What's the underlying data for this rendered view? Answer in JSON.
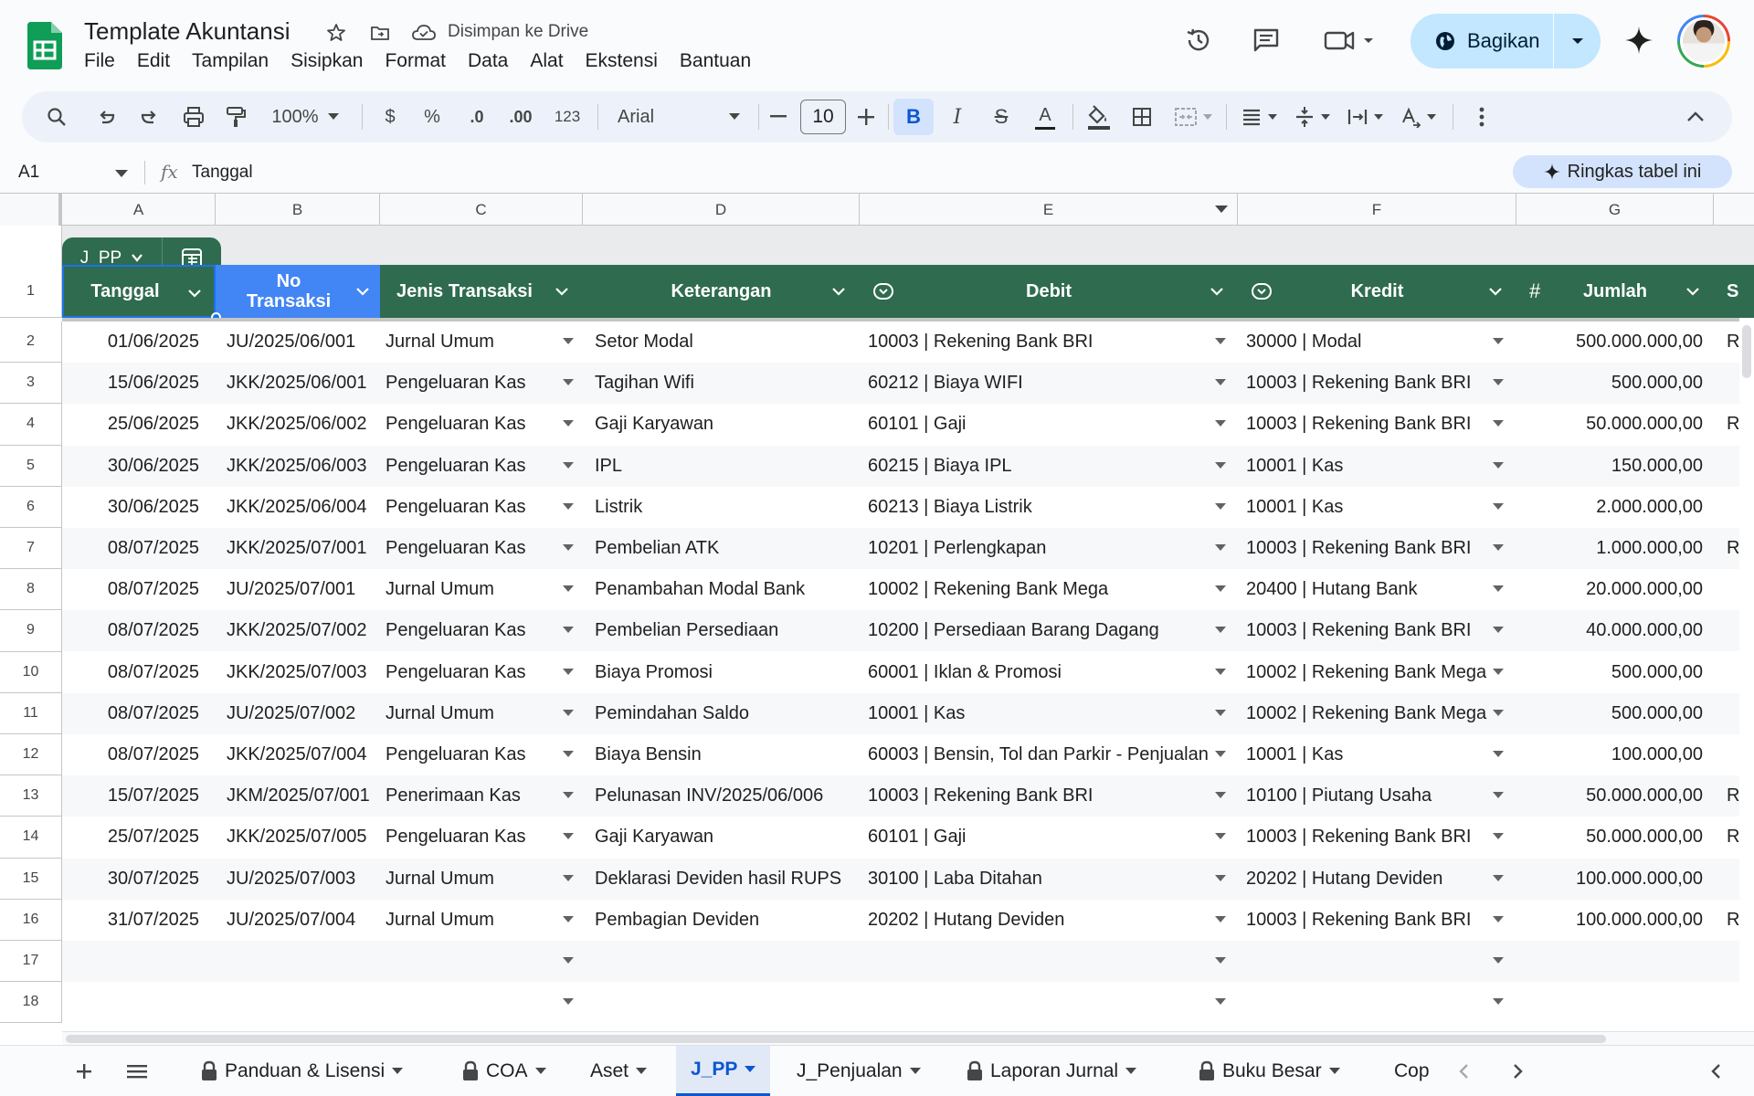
{
  "app": {
    "title": "Template Akuntansi",
    "save_status": "Disimpan ke Drive",
    "share_label": "Bagikan",
    "menus": [
      "File",
      "Edit",
      "Tampilan",
      "Sisipkan",
      "Format",
      "Data",
      "Alat",
      "Ekstensi",
      "Bantuan"
    ]
  },
  "toolbar": {
    "zoom": "100%",
    "currency": "$",
    "percent": "%",
    "decrease_decimal": ".0",
    "increase_decimal": ".00",
    "number_format": "123",
    "font": "Arial",
    "font_size": "10",
    "bold": "B",
    "italic": "I",
    "strike": "S",
    "text_color": "A"
  },
  "formula_bar": {
    "cell_ref": "A1",
    "fx": "fx",
    "value": "Tanggal",
    "ai_button": "Ringkas tabel ini"
  },
  "columns": [
    "A",
    "B",
    "C",
    "D",
    "E",
    "F",
    "G"
  ],
  "table": {
    "name": "J_PP",
    "headers": {
      "tanggal": "Tanggal",
      "no1": "No",
      "no2": "Transaksi",
      "jenis": "Jenis Transaksi",
      "ket": "Keterangan",
      "debit": "Debit",
      "kredit": "Kredit",
      "jumlah_icon": "#",
      "jumlah": "Jumlah",
      "next": "S"
    },
    "rows": [
      {
        "n": "2",
        "tgl": "01/06/2025",
        "no": "JU/2025/06/001",
        "jenis": "Jurnal Umum",
        "ket": "Setor Modal",
        "debit": "10003 | Rekening Bank BRI",
        "kredit": "30000 | Modal",
        "jumlah": "500.000.000,00",
        "next": "R"
      },
      {
        "n": "3",
        "tgl": "15/06/2025",
        "no": "JKK/2025/06/001",
        "jenis": "Pengeluaran Kas",
        "ket": "Tagihan Wifi",
        "debit": "60212 | Biaya WIFI",
        "kredit": "10003 | Rekening Bank BRI",
        "jumlah": "500.000,00",
        "next": ""
      },
      {
        "n": "4",
        "tgl": "25/06/2025",
        "no": "JKK/2025/06/002",
        "jenis": "Pengeluaran Kas",
        "ket": "Gaji Karyawan",
        "debit": "60101 | Gaji",
        "kredit": "10003 | Rekening Bank BRI",
        "jumlah": "50.000.000,00",
        "next": "R"
      },
      {
        "n": "5",
        "tgl": "30/06/2025",
        "no": "JKK/2025/06/003",
        "jenis": "Pengeluaran Kas",
        "ket": "IPL",
        "debit": "60215 | Biaya IPL",
        "kredit": "10001 | Kas",
        "jumlah": "150.000,00",
        "next": ""
      },
      {
        "n": "6",
        "tgl": "30/06/2025",
        "no": "JKK/2025/06/004",
        "jenis": "Pengeluaran Kas",
        "ket": "Listrik",
        "debit": "60213 | Biaya Listrik",
        "kredit": "10001 | Kas",
        "jumlah": "2.000.000,00",
        "next": ""
      },
      {
        "n": "7",
        "tgl": "08/07/2025",
        "no": "JKK/2025/07/001",
        "jenis": "Pengeluaran Kas",
        "ket": "Pembelian ATK",
        "debit": "10201 | Perlengkapan",
        "kredit": "10003 | Rekening Bank BRI",
        "jumlah": "1.000.000,00",
        "next": "R"
      },
      {
        "n": "8",
        "tgl": "08/07/2025",
        "no": "JU/2025/07/001",
        "jenis": "Jurnal Umum",
        "ket": "Penambahan Modal Bank",
        "debit": "10002 | Rekening Bank Mega",
        "kredit": "20400 | Hutang Bank",
        "jumlah": "20.000.000,00",
        "next": ""
      },
      {
        "n": "9",
        "tgl": "08/07/2025",
        "no": "JKK/2025/07/002",
        "jenis": "Pengeluaran Kas",
        "ket": "Pembelian Persediaan",
        "debit": "10200 | Persediaan Barang Dagang",
        "kredit": "10003 | Rekening Bank BRI",
        "jumlah": "40.000.000,00",
        "next": ""
      },
      {
        "n": "10",
        "tgl": "08/07/2025",
        "no": "JKK/2025/07/003",
        "jenis": "Pengeluaran Kas",
        "ket": "Biaya Promosi",
        "debit": "60001 | Iklan & Promosi",
        "kredit": "10002 | Rekening Bank Mega",
        "jumlah": "500.000,00",
        "next": ""
      },
      {
        "n": "11",
        "tgl": "08/07/2025",
        "no": "JU/2025/07/002",
        "jenis": "Jurnal Umum",
        "ket": "Pemindahan Saldo",
        "debit": "10001 | Kas",
        "kredit": "10002 | Rekening Bank Mega",
        "jumlah": "500.000,00",
        "next": ""
      },
      {
        "n": "12",
        "tgl": "08/07/2025",
        "no": "JKK/2025/07/004",
        "jenis": "Pengeluaran Kas",
        "ket": "Biaya Bensin",
        "debit": "60003 | Bensin, Tol dan Parkir - Penjualan",
        "kredit": "10001 | Kas",
        "jumlah": "100.000,00",
        "next": ""
      },
      {
        "n": "13",
        "tgl": "15/07/2025",
        "no": "JKM/2025/07/001",
        "jenis": "Penerimaan Kas",
        "ket": "Pelunasan INV/2025/06/006",
        "debit": "10003 | Rekening Bank BRI",
        "kredit": "10100 | Piutang Usaha",
        "jumlah": "50.000.000,00",
        "next": "R"
      },
      {
        "n": "14",
        "tgl": "25/07/2025",
        "no": "JKK/2025/07/005",
        "jenis": "Pengeluaran Kas",
        "ket": "Gaji Karyawan",
        "debit": "60101 | Gaji",
        "kredit": "10003 | Rekening Bank BRI",
        "jumlah": "50.000.000,00",
        "next": "R"
      },
      {
        "n": "15",
        "tgl": "30/07/2025",
        "no": "JU/2025/07/003",
        "jenis": "Jurnal Umum",
        "ket": "Deklarasi Deviden hasil RUPS",
        "debit": "30100 | Laba Ditahan",
        "kredit": "20202 | Hutang Deviden",
        "jumlah": "100.000.000,00",
        "next": ""
      },
      {
        "n": "16",
        "tgl": "31/07/2025",
        "no": "JU/2025/07/004",
        "jenis": "Jurnal Umum",
        "ket": "Pembagian Deviden",
        "debit": "20202 | Hutang Deviden",
        "kredit": "10003 | Rekening Bank BRI",
        "jumlah": "100.000.000,00",
        "next": "R"
      },
      {
        "n": "17",
        "tgl": "",
        "no": "",
        "jenis": "",
        "ket": "",
        "debit": "",
        "kredit": "",
        "jumlah": "",
        "next": ""
      },
      {
        "n": "18",
        "tgl": "",
        "no": "",
        "jenis": "",
        "ket": "",
        "debit": "",
        "kredit": "",
        "jumlah": "",
        "next": ""
      }
    ]
  },
  "row_header_1": "1",
  "sheets": [
    {
      "label": "Panduan & Lisensi",
      "locked": true,
      "active": false
    },
    {
      "label": "COA",
      "locked": true,
      "active": false
    },
    {
      "label": "Aset",
      "locked": false,
      "active": false
    },
    {
      "label": "J_PP",
      "locked": false,
      "active": true
    },
    {
      "label": "J_Penjualan",
      "locked": false,
      "active": false
    },
    {
      "label": "Laporan Jurnal",
      "locked": true,
      "active": false
    },
    {
      "label": "Buku Besar",
      "locked": true,
      "active": false
    },
    {
      "label": "Cop",
      "locked": false,
      "active": false
    }
  ],
  "colors": {
    "table_header": "#2f6b4f",
    "selected_header": "#4285f4",
    "share_button": "#c2e7ff",
    "active_tab": "#0b57d0"
  }
}
